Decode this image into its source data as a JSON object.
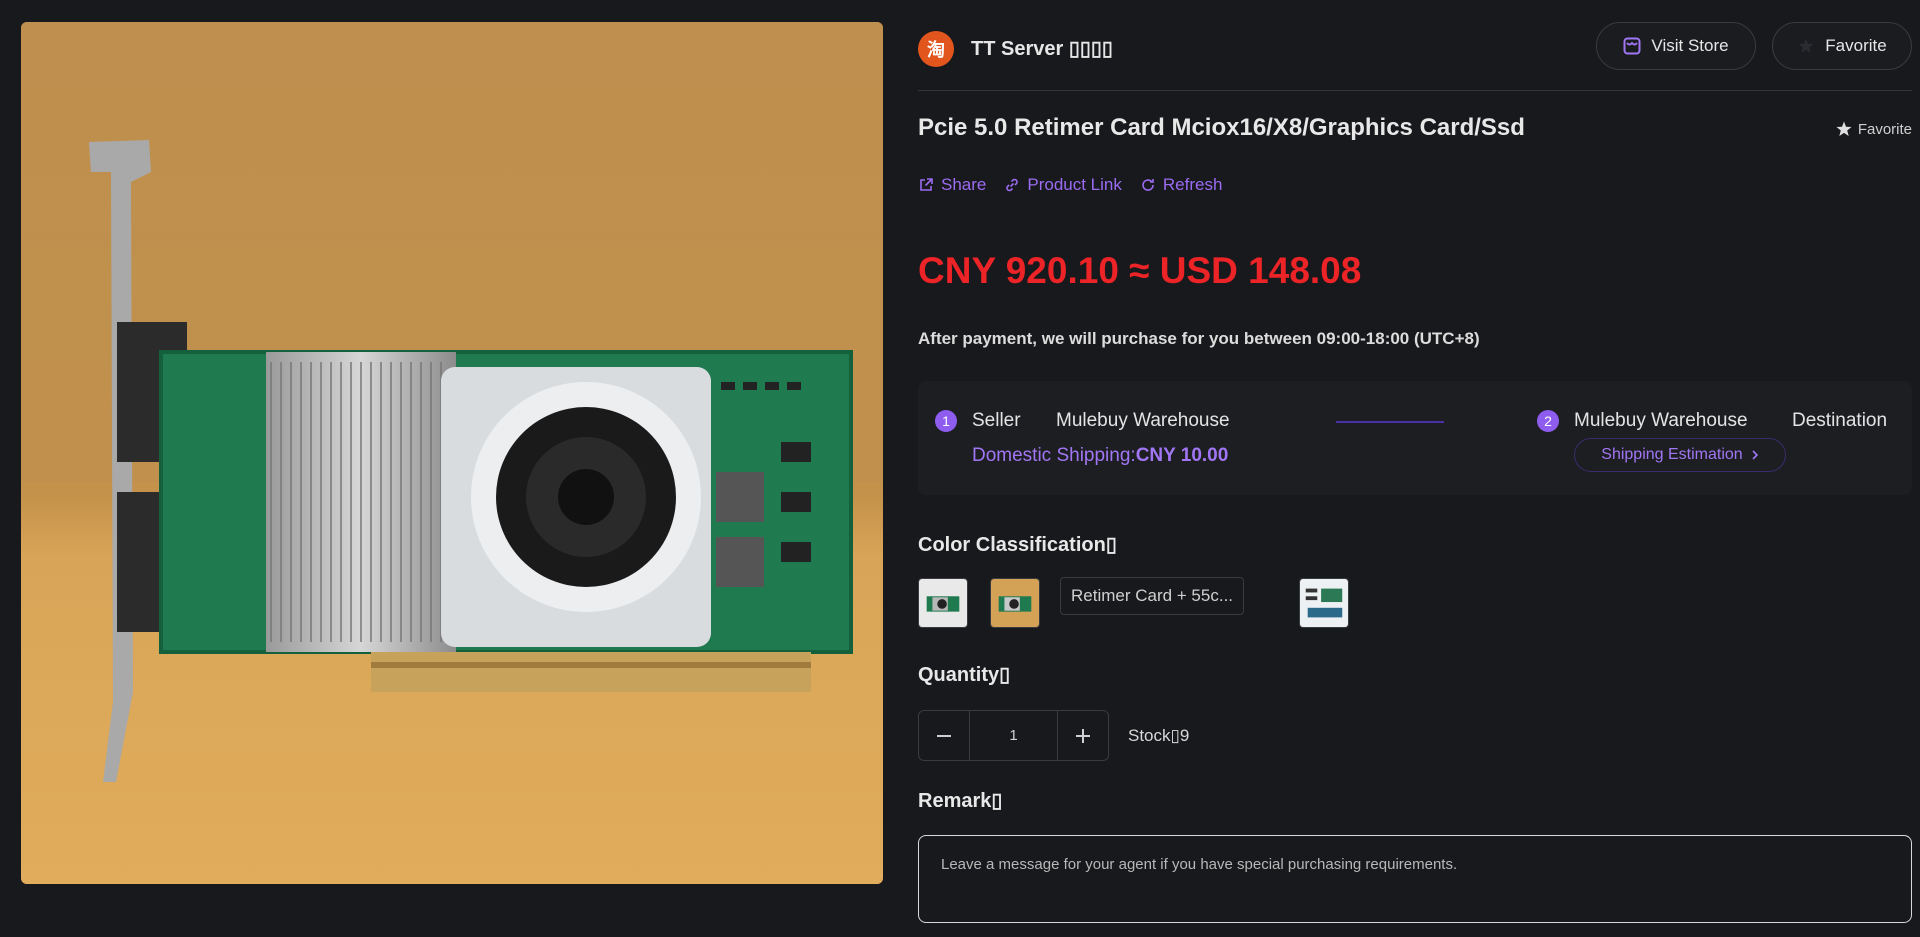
{
  "product_image": {
    "alt": "Retimer card product photo"
  },
  "store": {
    "logo_text": "淘",
    "name": "TT Server ▯▯▯▯",
    "visit_label": "Visit Store",
    "favorite_label": "Favorite"
  },
  "product": {
    "title": "Pcie 5.0 Retimer Card Mciox16/X8/Graphics Card/Ssd",
    "favorite_label": "Favorite",
    "actions": {
      "share": "Share",
      "product_link": "Product Link",
      "refresh": "Refresh"
    },
    "price": "CNY 920.10 ≈ USD 148.08",
    "notice": "After payment, we will purchase for you between 09:00-18:00 (UTC+8)"
  },
  "shipping": {
    "step1_num": "1",
    "step1_from": "Seller",
    "step1_to": "Mulebuy Warehouse",
    "step2_num": "2",
    "step2_from": "Mulebuy Warehouse",
    "step2_to": "Destination",
    "domestic_label": "Domestic Shipping:",
    "domestic_value": "CNY 10.00",
    "estimation_label": "Shipping Estimation"
  },
  "color": {
    "label": "Color Classification▯",
    "selected_text": "Retimer Card + 55c..."
  },
  "quantity": {
    "label": "Quantity▯",
    "value": "1",
    "stock": "Stock▯9"
  },
  "remark": {
    "label": "Remark▯",
    "placeholder": "Leave a message for your agent if you have special purchasing requirements."
  },
  "colors": {
    "accent": "#9b6bf2",
    "price": "#ec2327",
    "background": "#18191c"
  }
}
